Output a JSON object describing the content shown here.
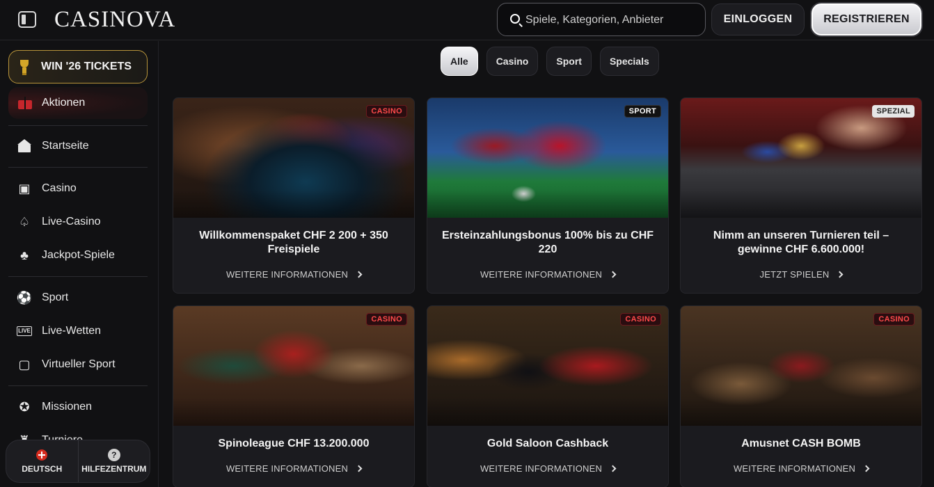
{
  "header": {
    "logo": "CASINOVA",
    "search_placeholder": "Spiele, Kategorien, Anbieter",
    "login_label": "EINLOGGEN",
    "register_label": "REGISTRIEREN"
  },
  "sidebar": {
    "promo_label": "WIN '26 TICKETS",
    "actions_label": "Aktionen",
    "items": [
      {
        "label": "Startseite",
        "icon": "home-icon"
      },
      {
        "label": "Casino",
        "icon": "slot-machine-icon"
      },
      {
        "label": "Live-Casino",
        "icon": "live-casino-icon"
      },
      {
        "label": "Jackpot-Spiele",
        "icon": "clover-icon"
      },
      {
        "label": "Sport",
        "icon": "soccer-ball-icon"
      },
      {
        "label": "Live-Wetten",
        "icon": "live-icon"
      },
      {
        "label": "Virtueller Sport",
        "icon": "virtual-sport-icon"
      },
      {
        "label": "Missionen",
        "icon": "medal-icon"
      },
      {
        "label": "Turniere",
        "icon": "tournament-icon"
      }
    ],
    "bottom": {
      "language_label": "DEUTSCH",
      "help_label": "HILFEZENTRUM"
    }
  },
  "filters": [
    "Alle",
    "Casino",
    "Sport",
    "Specials"
  ],
  "active_filter": "Alle",
  "cards": [
    {
      "badge": "CASINO",
      "title": "Willkommenspaket CHF 2 200 + 350 Freispiele",
      "cta": "WEITERE INFORMATIONEN"
    },
    {
      "badge": "SPORT",
      "title": "Ersteinzahlungsbonus 100% bis zu CHF 220",
      "cta": "WEITERE INFORMATIONEN"
    },
    {
      "badge": "SPEZIAL",
      "title": "Nimm an unseren Turnieren teil – gewinne CHF 6.600.000!",
      "cta": "JETZT SPIELEN"
    },
    {
      "badge": "CASINO",
      "title": "Spinoleague CHF 13.200.000",
      "cta": "WEITERE INFORMATIONEN"
    },
    {
      "badge": "CASINO",
      "title": "Gold Saloon Cashback",
      "cta": "WEITERE INFORMATIONEN"
    },
    {
      "badge": "CASINO",
      "title": "Amusnet CASH BOMB",
      "cta": "WEITERE INFORMATIONEN"
    }
  ],
  "colors": {
    "background": "#111113",
    "accent_red": "#c7262c",
    "accent_gold": "#b8943a"
  }
}
